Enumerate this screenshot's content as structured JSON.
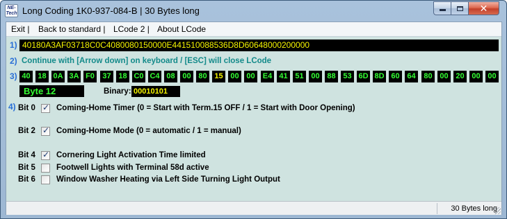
{
  "window": {
    "title": "Long Coding  1K0-937-084-B | 30 Bytes long",
    "icon_text": "NE-Tech",
    "controls": {
      "minimize_icon": "minimize-icon",
      "maximize_icon": "maximize-icon",
      "close_label": "✕"
    }
  },
  "menu": {
    "items": [
      "Exit |",
      "Back to standard |",
      "LCode 2 |",
      "About LCode"
    ]
  },
  "step_numbers": [
    "1)",
    "2)",
    "3)",
    "4)"
  ],
  "coding_string": "40180A3AF03718C0C4080080150000E441510088536D8D60648000200000",
  "info": "Continue with [Arrow down] on keyboard / [ESC] will close LCode",
  "bytes": [
    "40",
    "18",
    "0A",
    "3A",
    "F0",
    "37",
    "18",
    "C0",
    "C4",
    "08",
    "00",
    "80",
    "15",
    "00",
    "00",
    "E4",
    "41",
    "51",
    "00",
    "88",
    "53",
    "6D",
    "8D",
    "60",
    "64",
    "80",
    "00",
    "20",
    "00",
    "00"
  ],
  "selected_byte_index": 12,
  "byte_label": "Byte 12",
  "binary": {
    "label": "Binary:",
    "value": "00010101"
  },
  "bits": [
    {
      "label": "Bit 0",
      "checked": true,
      "desc": "Coming-Home Timer (0 = Start with Term.15 OFF / 1 = Start with Door Opening)"
    },
    {
      "label": "Bit 2",
      "checked": true,
      "desc": "Coming-Home Mode (0 = automatic / 1 = manual)"
    },
    {
      "label": "Bit 4",
      "checked": true,
      "desc": "Cornering Light Activation Time limited"
    },
    {
      "label": "Bit 5",
      "checked": false,
      "desc": "Footwell Lights with Terminal 58d active"
    },
    {
      "label": "Bit 6",
      "checked": false,
      "desc": "Window Washer Heating via Left Side Turning Light Output"
    }
  ],
  "status": {
    "text": "30 Bytes long"
  },
  "colors": {
    "byte_text": "#34ff34",
    "selected_byte_text": "#f5f500",
    "coding_text": "#f5f500",
    "info_text": "#138a8a",
    "step_number": "#2a6fd6"
  }
}
